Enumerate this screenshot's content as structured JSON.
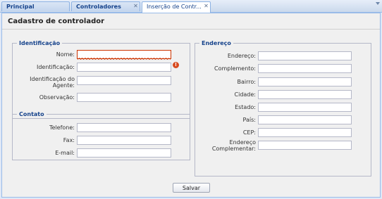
{
  "tabs": [
    {
      "label": "Principal",
      "closable": false,
      "active": false
    },
    {
      "label": "Controladores",
      "closable": true,
      "active": false
    },
    {
      "label": "Inserção de Contr...",
      "closable": true,
      "active": true
    }
  ],
  "panel": {
    "title": "Cadastro de controlador"
  },
  "identificacao": {
    "legend": "Identificação",
    "fields": {
      "nome": {
        "label": "Nome:",
        "value": "",
        "invalid": true
      },
      "identificacao": {
        "label": "Identificação:",
        "value": ""
      },
      "identificacao_agente": {
        "label_line1": "Identificação do",
        "label_line2": "Agente:",
        "value": ""
      },
      "observacao": {
        "label": "Observação:",
        "value": ""
      }
    }
  },
  "contato": {
    "legend": "Contato",
    "fields": {
      "telefone": {
        "label": "Telefone:",
        "value": ""
      },
      "fax": {
        "label": "Fax:",
        "value": ""
      },
      "email": {
        "label": "E-mail:",
        "value": ""
      }
    }
  },
  "endereco": {
    "legend": "Endereço",
    "fields": {
      "endereco": {
        "label": "Endereço:",
        "value": ""
      },
      "complemento": {
        "label": "Complemento:",
        "value": ""
      },
      "bairro": {
        "label": "Bairro:",
        "value": ""
      },
      "cidade": {
        "label": "Cidade:",
        "value": ""
      },
      "estado": {
        "label": "Estado:",
        "value": ""
      },
      "pais": {
        "label": "País:",
        "value": ""
      },
      "cep": {
        "label": "CEP:",
        "value": ""
      },
      "endereco_complementar": {
        "label_line1": "Endereço",
        "label_line2": "Complementar:",
        "value": ""
      }
    }
  },
  "actions": {
    "save_label": "Salvar"
  },
  "colors": {
    "accent": "#15428b",
    "error": "#cc3300",
    "panel_bg": "#f0f0f0"
  },
  "icons": {
    "tab_close": "close-icon",
    "error": "exclamation-icon",
    "tab_menu": "chevron-down-icon"
  }
}
